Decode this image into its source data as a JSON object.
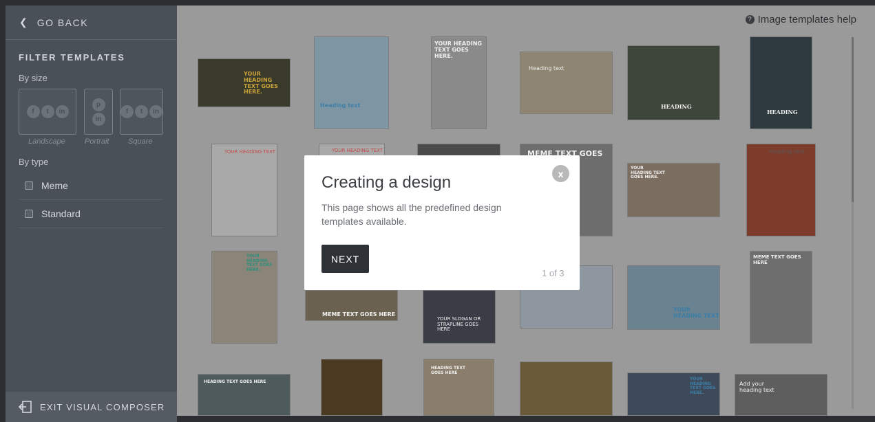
{
  "sidebar": {
    "go_back_label": "GO BACK",
    "filter_title": "FILTER TEMPLATES",
    "by_size_label": "By size",
    "sizes": [
      {
        "caption": "Landscape",
        "icons": [
          "facebook-icon",
          "twitter-icon",
          "linkedin-icon"
        ]
      },
      {
        "caption": "Portrait",
        "icons": [
          "pinterest-icon",
          "linkedin-icon"
        ]
      },
      {
        "caption": "Square",
        "icons": [
          "facebook-icon",
          "twitter-icon",
          "linkedin-icon"
        ]
      }
    ],
    "by_type_label": "By type",
    "types": [
      {
        "label": "Meme",
        "checked": false
      },
      {
        "label": "Standard",
        "checked": false
      }
    ],
    "exit_label": "EXIT VISUAL COMPOSER"
  },
  "main": {
    "help_label": "Image templates help",
    "templates": [
      {
        "caption": "YOUR HEADING TEXT GOES HERE.",
        "color": "#3a3a2a"
      },
      {
        "caption": "Heading text",
        "color": "#7e96a4"
      },
      {
        "caption": "YOUR HEADING TEXT GOES HERE.",
        "color": "#8a8a8a"
      },
      {
        "caption": "Heading text",
        "color": "#8e8672"
      },
      {
        "caption": "HEADING",
        "color": "#3e463c"
      },
      {
        "caption": "HEADING",
        "color": "#2f3a40"
      },
      {
        "caption": "YOUR HEADING TEXT",
        "color": "#a9a9a9"
      },
      {
        "caption": "YOUR HEADING TEXT",
        "color": "#a9a9a9"
      },
      {
        "caption": "",
        "color": "#4a4a4a"
      },
      {
        "caption": "MEME TEXT GOES HERE",
        "color": "#6d6d6d"
      },
      {
        "caption": "YOUR HEADING TEXT GOES HERE.",
        "color": "#7b6d60"
      },
      {
        "caption": "Heading text",
        "color": "#7d3b2c"
      },
      {
        "caption": "YOUR HEADING TEXT GOES HERE.",
        "color": "#8b8478"
      },
      {
        "caption": "MEME TEXT GOES HERE",
        "color": "#6b6150"
      },
      {
        "caption": "YOUR SLOGAN OR STRAPLINE GOES HERE",
        "color": "#3a3d45"
      },
      {
        "caption": "",
        "color": "#8e96a0"
      },
      {
        "caption": "YOUR HEADING TEXT",
        "color": "#6b8291"
      },
      {
        "caption": "MEME TEXT GOES HERE",
        "color": "#6e6e6e"
      },
      {
        "caption": "HEADING TEXT GOES HERE",
        "color": "#4e5a5c"
      },
      {
        "caption": "",
        "color": "#4a3a22"
      },
      {
        "caption": "HEADING TEXT GOES HERE",
        "color": "#8b7d6b"
      },
      {
        "caption": "",
        "color": "#6b5a3a"
      },
      {
        "caption": "YOUR HEADING TEXT GOES HERE.",
        "color": "#3e4a5a"
      },
      {
        "caption": "Add your heading text",
        "color": "#5e5e5e"
      }
    ]
  },
  "modal": {
    "title": "Creating a design",
    "body": "This page shows all the predefined design templates available.",
    "close_label": "x",
    "next_label": "NEXT",
    "step": "1 of 3"
  }
}
